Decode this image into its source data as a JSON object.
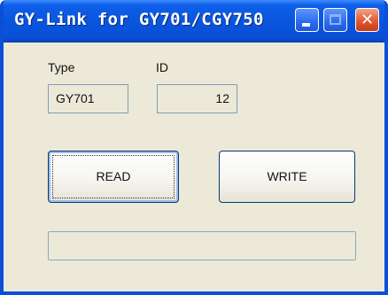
{
  "window": {
    "title": "GY-Link for GY701/CGY750",
    "minimize_icon": "minimize-icon",
    "maximize_icon": "maximize-icon",
    "close_icon": "close-icon"
  },
  "form": {
    "type_label": "Type",
    "type_value": "GY701",
    "id_label": "ID",
    "id_value": "12",
    "read_button": "READ",
    "write_button": "WRITE",
    "progress": 0
  },
  "colors": {
    "titlebar": "#0a55dd",
    "window_bg": "#ece9d8",
    "close_button": "#e05a2f",
    "field_border": "#7f9db9"
  }
}
